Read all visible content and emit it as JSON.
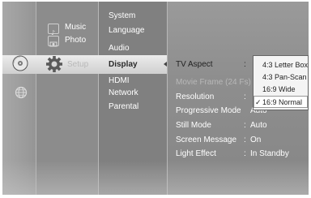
{
  "categories": {
    "music_label": "Music",
    "photo_label": "Photo",
    "setup_label": "Setup"
  },
  "setup_menu": [
    {
      "label": "System"
    },
    {
      "label": "Language"
    },
    {
      "label": "Audio"
    },
    {
      "label": "Display"
    },
    {
      "label": "HDMI"
    },
    {
      "label": "Network"
    },
    {
      "label": "Parental"
    }
  ],
  "display_settings": [
    {
      "label": "TV Aspect",
      "value": ""
    },
    {
      "label": "Movie Frame (24 Fs)",
      "value": ""
    },
    {
      "label": "Resolution",
      "value": ""
    },
    {
      "label": "Progressive Mode",
      "value": "Auto"
    },
    {
      "label": "Still Mode",
      "value": "Auto"
    },
    {
      "label": "Screen Message",
      "value": "On"
    },
    {
      "label": "Light Effect",
      "value": "In Standby"
    }
  ],
  "colon": ":",
  "tv_aspect_options": [
    {
      "label": "4:3 Letter Box"
    },
    {
      "label": "4:3 Pan-Scan"
    },
    {
      "label": "16:9 Wide"
    },
    {
      "label": "16:9 Normal",
      "checked": true,
      "check_mark": "✓"
    }
  ],
  "icons": [
    "disc-icon",
    "globe-icon",
    "music-icon",
    "photo-icon",
    "gear-icon",
    "checkmark-icon"
  ]
}
